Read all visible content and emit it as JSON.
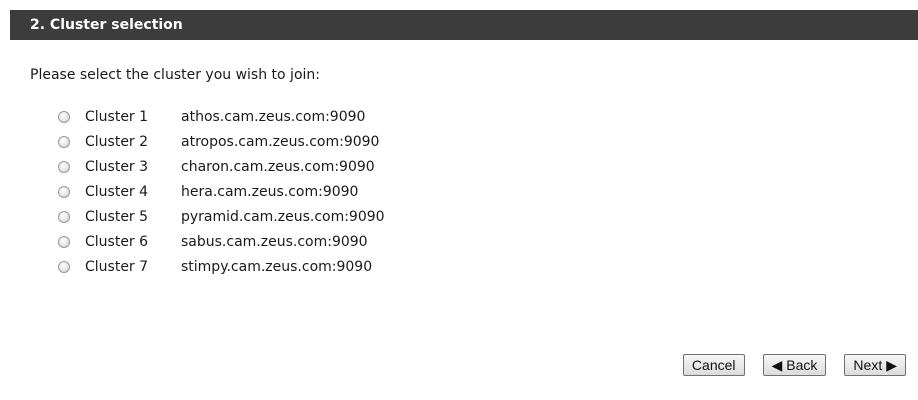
{
  "header": {
    "title": "2. Cluster selection"
  },
  "prompt": "Please select the cluster you wish to join:",
  "clusters": [
    {
      "name": "Cluster 1",
      "host": "athos.cam.zeus.com:9090"
    },
    {
      "name": "Cluster 2",
      "host": "atropos.cam.zeus.com:9090"
    },
    {
      "name": "Cluster 3",
      "host": "charon.cam.zeus.com:9090"
    },
    {
      "name": "Cluster 4",
      "host": "hera.cam.zeus.com:9090"
    },
    {
      "name": "Cluster 5",
      "host": "pyramid.cam.zeus.com:9090"
    },
    {
      "name": "Cluster 6",
      "host": "sabus.cam.zeus.com:9090"
    },
    {
      "name": "Cluster 7",
      "host": "stimpy.cam.zeus.com:9090"
    }
  ],
  "buttons": {
    "cancel": "Cancel",
    "back": "Back",
    "back_icon": "◀",
    "next": "Next",
    "next_icon": "▶"
  }
}
